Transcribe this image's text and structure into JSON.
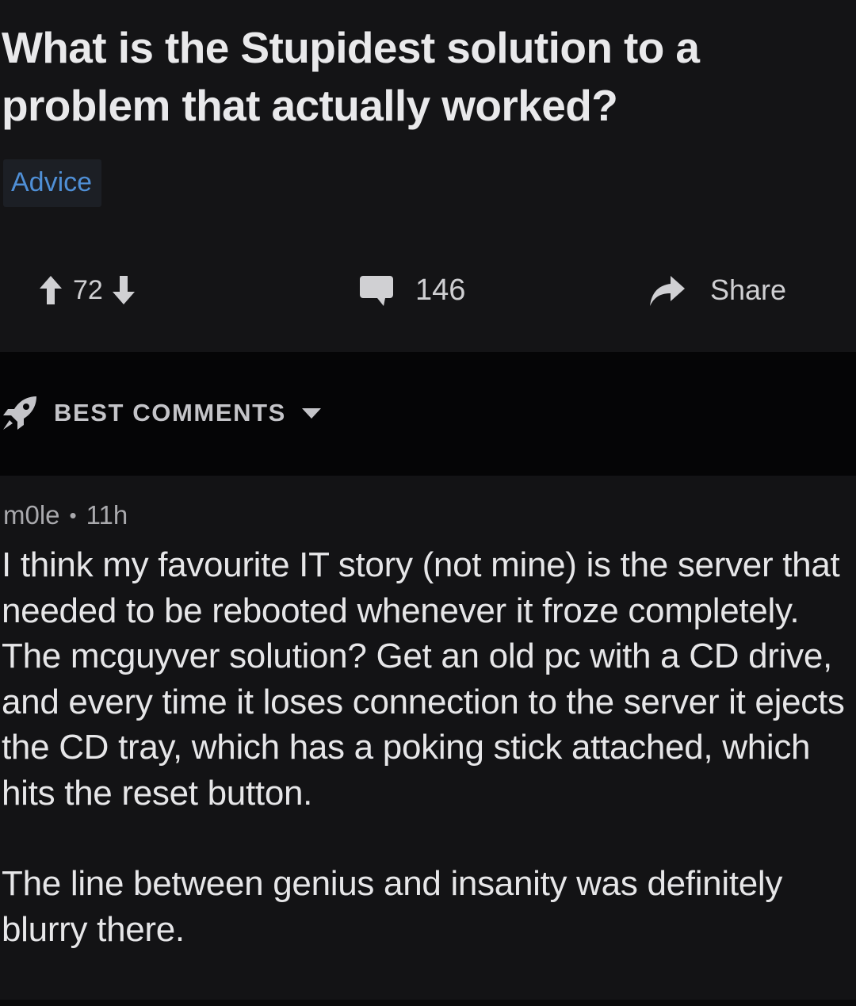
{
  "post": {
    "title": "What is the Stupidest solution to a problem that actually worked?",
    "flair": "Advice",
    "upvotes": "72",
    "comment_count": "146",
    "share_label": "Share"
  },
  "sort": {
    "label": "BEST COMMENTS"
  },
  "comment": {
    "author": "m0le",
    "separator": "•",
    "age": "11h",
    "paragraphs": [
      "I think my favourite IT story (not mine) is the server that needed to be rebooted whenever it froze completely. The mcguyver solution? Get an old pc with a CD drive, and every time it loses connection to the server it ejects the CD tray, which has a poking stick attached, which hits the reset button.",
      "The line between genius and insanity was definitely blurry there."
    ]
  },
  "colors": {
    "background": "#131315",
    "sortbar": "#050506",
    "flair_text": "#4f8fd6",
    "text": "#e6e6e8"
  },
  "icons": [
    "upvote-icon",
    "downvote-icon",
    "comment-icon",
    "share-icon",
    "rocket-icon",
    "caret-down-icon"
  ]
}
